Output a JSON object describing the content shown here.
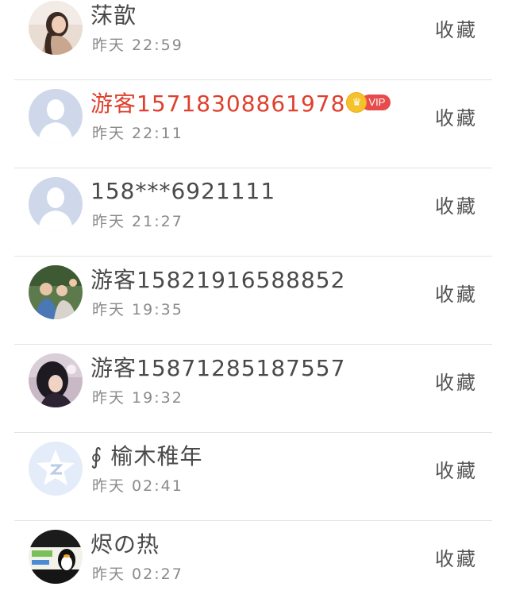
{
  "contacts": [
    {
      "name": "莯歆",
      "time": "昨天 22:59",
      "action": "收藏",
      "avatar": "photo-woman-light"
    },
    {
      "name": "游客15718308861978",
      "time": "昨天 22:11",
      "action": "收藏",
      "avatar": "default-user-icon",
      "vip": true,
      "vip_label": "VIP",
      "crown": "♛"
    },
    {
      "name": "158***6921111",
      "time": "昨天 21:27",
      "action": "收藏",
      "avatar": "default-user-icon"
    },
    {
      "name": "游客15821916588852",
      "time": "昨天 19:35",
      "action": "收藏",
      "avatar": "photo-group"
    },
    {
      "name": "游客15871285187557",
      "time": "昨天 19:32",
      "action": "收藏",
      "avatar": "photo-dark-hair"
    },
    {
      "name": "∮ 榆木稚年",
      "time": "昨天 02:41",
      "action": "收藏",
      "avatar": "qq-star-icon"
    },
    {
      "name": "烬の热",
      "time": "昨天 02:27",
      "action": "收藏",
      "avatar": "photo-penguin"
    }
  ],
  "colors": {
    "vip_name": "#e0402d",
    "vip_pill": "#e84b4b",
    "crown": "#f6c22b",
    "default_avatar_bg": "#cfd8ea",
    "qq_star_bg": "#e3ecf8"
  }
}
